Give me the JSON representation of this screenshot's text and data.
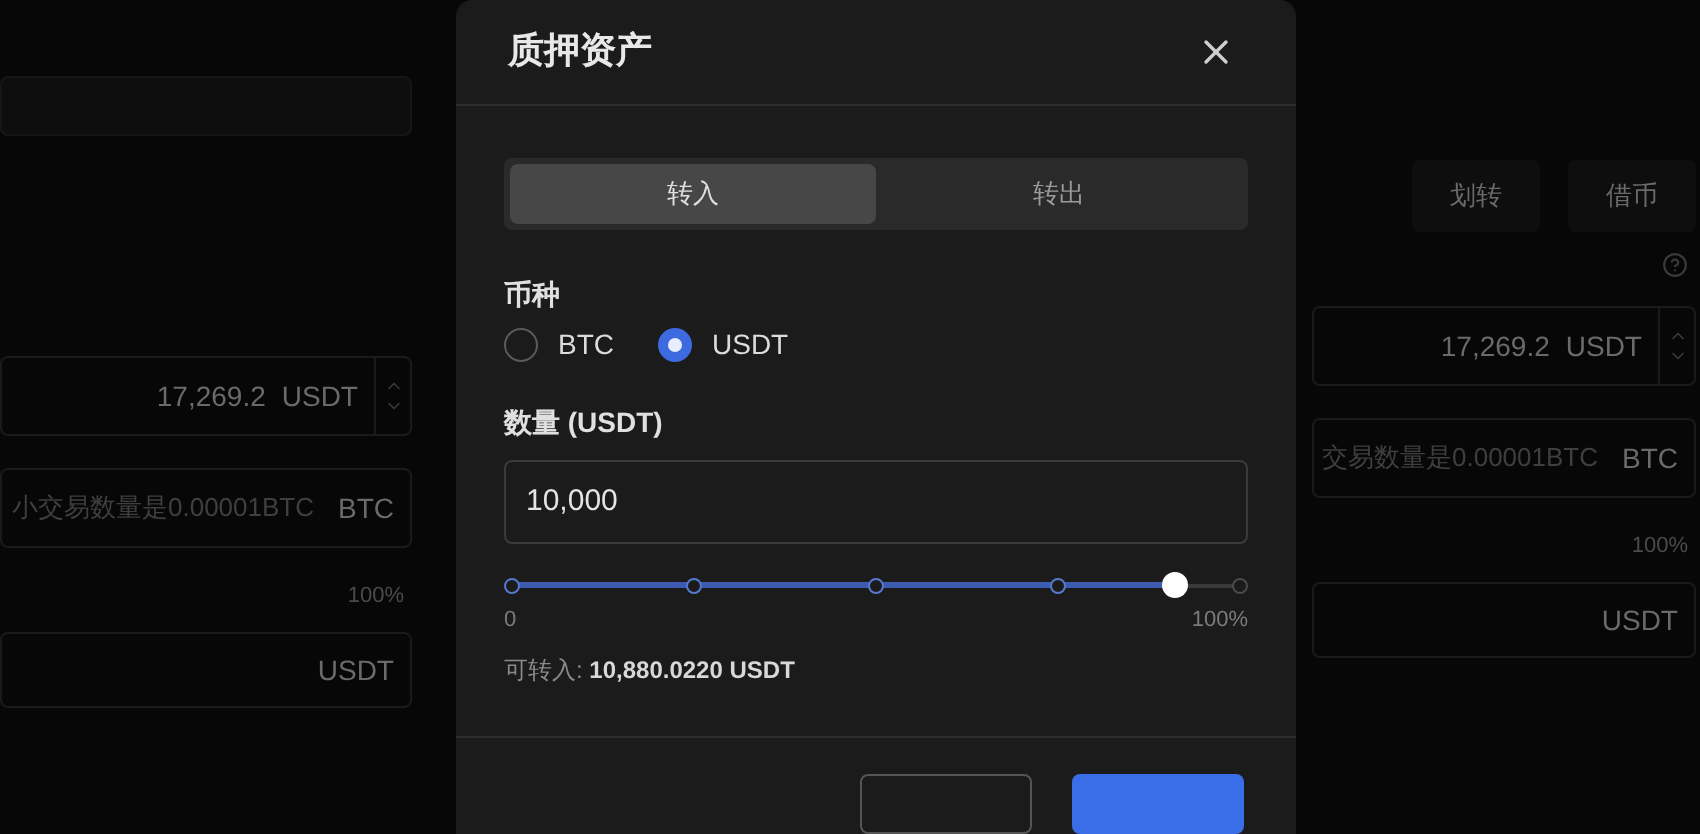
{
  "background": {
    "left_panel": {
      "fields": [
        {
          "kind": "blank"
        },
        {
          "kind": "amount",
          "value": "17,269.2",
          "unit": "USDT"
        },
        {
          "kind": "placeholder",
          "placeholder": "小交易数量是0.00001BTC",
          "unit": "BTC"
        },
        {
          "kind": "percent",
          "value": "100%"
        },
        {
          "kind": "unit",
          "unit": "USDT"
        }
      ]
    },
    "right_panel": {
      "buttons": [
        "划转",
        "借币"
      ],
      "fields": [
        {
          "kind": "amount",
          "value": "17,269.2",
          "unit": "USDT"
        },
        {
          "kind": "placeholder",
          "placeholder": "交易数量是0.00001BTC",
          "unit": "BTC"
        },
        {
          "kind": "percent",
          "value": "100%"
        },
        {
          "kind": "unit",
          "unit": "USDT"
        }
      ]
    }
  },
  "dialog": {
    "title": "质押资产",
    "tabs": [
      {
        "label": "转入",
        "selected": true
      },
      {
        "label": "转出",
        "selected": false
      }
    ],
    "currency": {
      "label": "币种",
      "options": [
        {
          "label": "BTC",
          "selected": false
        },
        {
          "label": "USDT",
          "selected": true
        }
      ]
    },
    "amount": {
      "label": "数量 (USDT)",
      "value": "10,000"
    },
    "slider": {
      "level": 0.91,
      "min_label": "0",
      "max_label": "100%"
    },
    "available": "可转入: **10,880.0220 USDT**",
    "buttons": [
      {
        "kind": "secondary"
      },
      {
        "kind": "primary"
      }
    ]
  }
}
